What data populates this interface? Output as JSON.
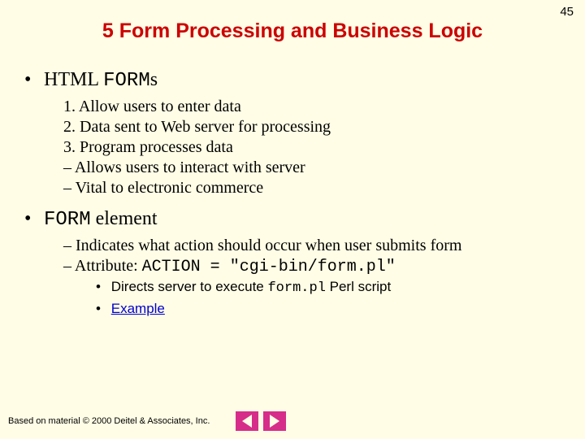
{
  "page_number": "45",
  "title": "5 Form Processing and Business Logic",
  "section1": {
    "heading_prefix": "HTML ",
    "heading_mono": "FORM",
    "heading_suffix": "s",
    "items": {
      "i1": "1. Allow users to enter data",
      "i2": "2. Data sent to Web server for processing",
      "i3": "3. Program processes data",
      "i4": "–  Allows users to interact with server",
      "i5": "–  Vital to electronic commerce"
    }
  },
  "section2": {
    "heading_mono": "FORM",
    "heading_suffix": " element",
    "items": {
      "i1": "–  Indicates what action should occur when user submits form",
      "i2_prefix": "–  Attribute: ",
      "i2_mono": "ACTION = \"cgi-bin/form.pl\""
    },
    "sub": {
      "s1_prefix": "Directs server to execute ",
      "s1_mono": "form.pl",
      "s1_suffix": " Perl script",
      "s2": "Example"
    }
  },
  "footer": "Based on material © 2000 Deitel & Associates, Inc."
}
